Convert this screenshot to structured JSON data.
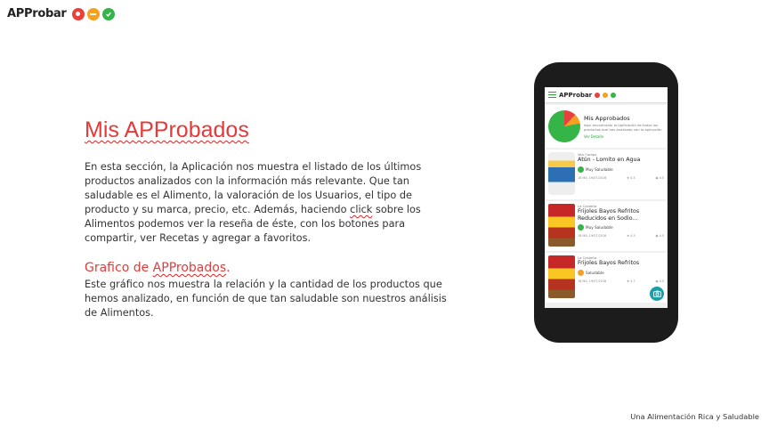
{
  "logo": {
    "text": "APProbar"
  },
  "slide": {
    "title": "Mis APProbados",
    "intro_before_click": "En esta sección, la Aplicación nos muestra el listado de los últimos productos analizados con la información más relevante. Que tan saludable es el Alimento, la valoración de los Usuarios, el tipo de producto y su marca, precio, etc. Además, haciendo ",
    "intro_click_word": "click",
    "intro_after_click": " sobre los Alimentos podemos ver la reseña de éste, con los botones para compartir, ver Recetas y agregar a favoritos.",
    "section_title_prefix": "Grafico de ",
    "section_title_word": "APProbados",
    "section_title_suffix": ".",
    "section_body": "Este gráfico nos muestra la relación y la cantidad de los productos que hemos analizado, en función de que tan saludable son nuestros análisis de Alimentos."
  },
  "phone": {
    "app_title": "APProbar",
    "summary": {
      "title": "Mis Approbados",
      "description": "Aquí encontrarás la tipificación de todos los productos que has analizado con la aplicación",
      "link": "Ver Detalle"
    },
    "products": [
      {
        "brand": "Van Camps",
        "name": "Atún - Lomito en Agua",
        "rating": "Muy Saludable",
        "rating_color": "#35b548",
        "date": "18 MA, 19/07/2016",
        "stars": "4.5",
        "views": "4.5"
      },
      {
        "brand": "La Costeña",
        "name": "Frijoles Bayos Refritos Reducidos en Sodio...",
        "rating": "Muy Saludable",
        "rating_color": "#35b548",
        "date": "18 MA, 19/07/2016",
        "stars": "4.5",
        "views": "4.5"
      },
      {
        "brand": "La Costeña",
        "name": "Frijoles Bayos Refritos",
        "rating": "Saludable",
        "rating_color": "#f4a11f",
        "date": "18 MA, 19/07/2016",
        "stars": "4.7",
        "views": "4.5"
      }
    ],
    "fab_icon": "camera-icon"
  },
  "footer": {
    "text": "Una Alimentación Rica y Saludable"
  }
}
